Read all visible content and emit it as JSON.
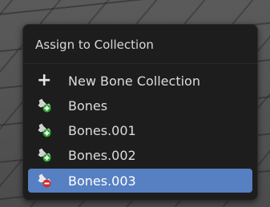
{
  "menu": {
    "title": "Assign to Collection",
    "items": [
      {
        "label": "New Bone Collection",
        "icon": "plus-icon",
        "highlighted": false
      },
      {
        "label": "Bones",
        "icon": "bone-collection-assign-icon",
        "highlighted": false
      },
      {
        "label": "Bones.001",
        "icon": "bone-collection-assign-icon",
        "highlighted": false
      },
      {
        "label": "Bones.002",
        "icon": "bone-collection-assign-icon",
        "highlighted": false
      },
      {
        "label": "Bones.003",
        "icon": "bone-collection-unassign-icon",
        "highlighted": true
      }
    ]
  },
  "colors": {
    "menu_bg": "#1d1d1d",
    "highlight": "#5680c2",
    "assign_badge": "#2fa52f",
    "unassign_badge": "#d42a2a"
  }
}
